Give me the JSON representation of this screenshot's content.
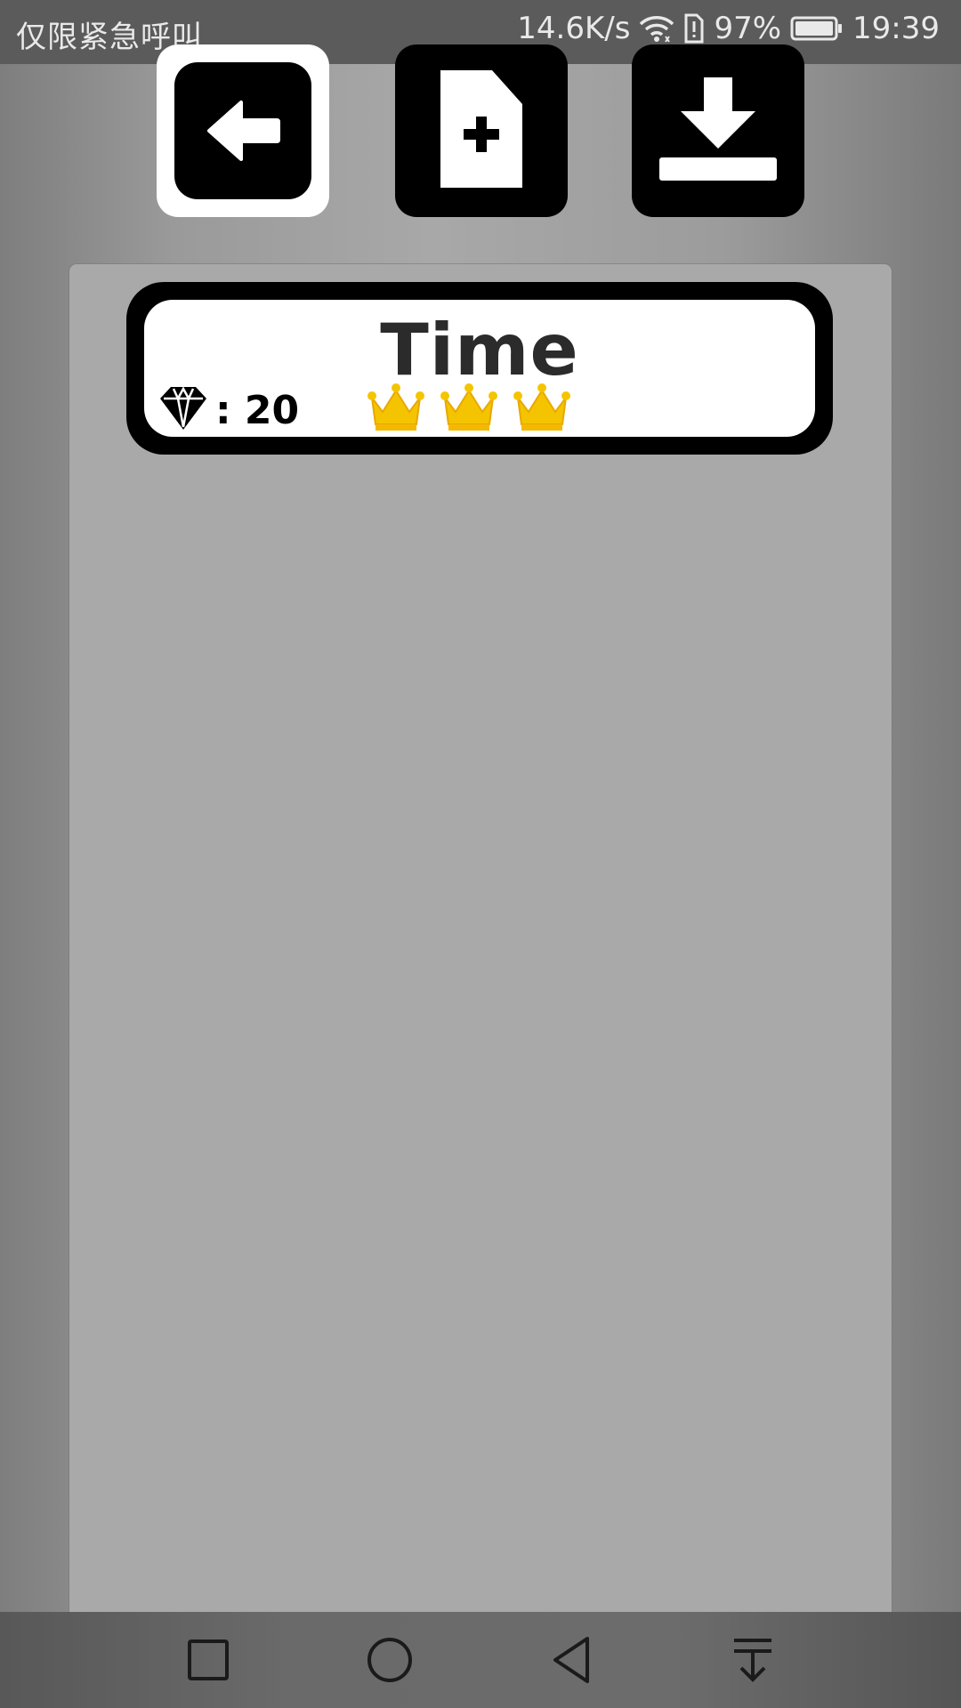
{
  "status_bar": {
    "carrier_text": "仅限紧急呼叫",
    "network_speed": "14.6K/s",
    "battery_percent": "97%",
    "time": "19:39",
    "icons": [
      "wifi-icon",
      "sim-alert-icon",
      "battery-icon"
    ]
  },
  "toolbar": {
    "buttons": [
      {
        "name": "back-button",
        "icon": "arrow-left-icon"
      },
      {
        "name": "new-file-button",
        "icon": "file-plus-icon"
      },
      {
        "name": "download-button",
        "icon": "download-icon"
      }
    ]
  },
  "levels": [
    {
      "title": "Time",
      "gem_label": ": 20",
      "gem_icon": "diamond-icon",
      "crowns": 3,
      "crown_color": "#f5c400"
    }
  ],
  "nav_bar": {
    "buttons": [
      "recents-square-icon",
      "home-circle-icon",
      "back-triangle-icon",
      "notification-pulldown-icon"
    ]
  },
  "colors": {
    "background": "#a9a9a9",
    "status_bar": "#5b5b5b",
    "nav_bar": "#6a6a6a",
    "button": "#000000",
    "crown": "#f5c400"
  }
}
